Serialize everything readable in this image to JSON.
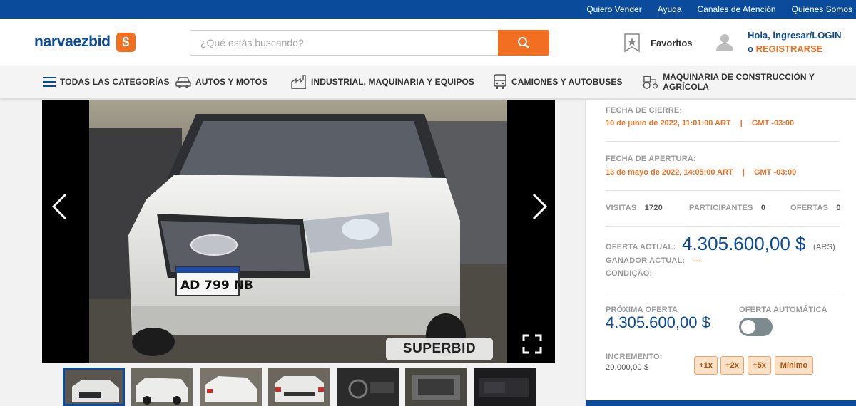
{
  "topbar": {
    "links": [
      "Quiero Vender",
      "Ayuda",
      "Canales de Atención",
      "Quiénes Somos"
    ]
  },
  "header": {
    "logo_text": "narvaezbid",
    "logo_badge": "$",
    "search_placeholder": "¿Qué estás buscando?",
    "favorites_label": "Favoritos",
    "greeting": "Hola, ingresar/",
    "login": "LOGIN",
    "or": "o ",
    "register": "REGISTRARSE"
  },
  "nav": {
    "items": [
      {
        "label": "TODAS LAS CATEGORÍAS",
        "icon": "menu-icon"
      },
      {
        "label": "AUTOS Y MOTOS",
        "icon": "car-icon"
      },
      {
        "label": "INDUSTRIAL, MAQUINARIA Y EQUIPOS",
        "icon": "factory-icon"
      },
      {
        "label": "CAMIONES Y AUTOBUSES",
        "icon": "bus-icon"
      },
      {
        "label": "MAQUINARIA DE CONSTRUCCIÓN Y AGRÍCOLA",
        "icon": "tractor-icon"
      }
    ]
  },
  "gallery": {
    "watermark": "SUPERBID",
    "thumb_count": 7
  },
  "lot": {
    "close_label": "FECHA DE CIERRE:",
    "close_date": "10 de junio de 2022, 11:01:00 ART",
    "close_tz": "GMT -03:00",
    "open_label": "FECHA DE APERTURA:",
    "open_date": "13 de mayo de 2022, 14:05:00 ART",
    "open_tz": "GMT -03:00",
    "visits_label": "VISITAS",
    "visits": "1720",
    "participants_label": "PARTICIPANTES",
    "participants": "0",
    "offers_label": "OFERTAS",
    "offers": "0",
    "current_offer_label": "OFERTA ACTUAL:",
    "current_offer": "4.305.600,00 $",
    "currency": "(ARS)",
    "winner_label": "GANADOR ACTUAL:",
    "winner": "---",
    "condition_label": "CONDIÇÃO:",
    "next_offer_label": "PRÓXIMA OFERTA",
    "next_offer": "4.305.600,00 $",
    "auto_offer_label": "OFERTA AUTOMÁTICA",
    "increment_label": "INCREMENTO:",
    "increment": "20.000,00 $",
    "multipliers": [
      "+1x",
      "+2x",
      "+5x",
      "Mínimo"
    ]
  },
  "colors": {
    "brand_blue": "#0b4b9b",
    "brand_orange": "#f26f21"
  }
}
